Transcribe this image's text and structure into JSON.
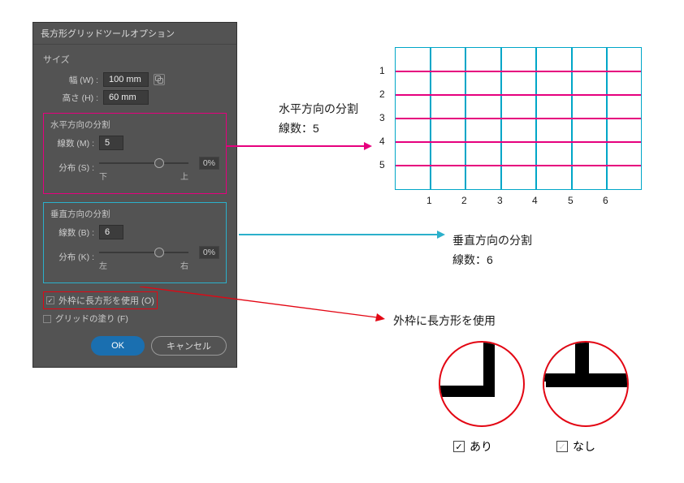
{
  "dialog": {
    "title": "長方形グリッドツールオプション",
    "section_size_label": "サイズ",
    "width_label": "幅 (W) :",
    "width_value": "100 mm",
    "height_label": "高さ (H) :",
    "height_value": "60 mm",
    "horiz_title": "水平方向の分割",
    "horiz_count_label": "線数 (M) :",
    "horiz_count_value": "5",
    "horiz_dist_label": "分布 (S) :",
    "horiz_dist_pct": "0%",
    "horiz_left": "下",
    "horiz_right": "上",
    "vert_title": "垂直方向の分割",
    "vert_count_label": "線数 (B) :",
    "vert_count_value": "6",
    "vert_dist_label": "分布 (K) :",
    "vert_dist_pct": "0%",
    "vert_left": "左",
    "vert_right": "右",
    "use_rect_label": "外枠に長方形を使用 (O)",
    "fill_grid_label": "グリッドの塗り (F)",
    "ok_label": "OK",
    "cancel_label": "キャンセル"
  },
  "annotations": {
    "horiz1": "水平方向の分割",
    "horiz2": "線数：5",
    "vert1": "垂直方向の分割",
    "vert2": "線数：6",
    "use_rect": "外枠に長方形を使用",
    "ari": "あり",
    "nashi": "なし"
  },
  "grid": {
    "row_labels": [
      "1",
      "2",
      "3",
      "4",
      "5"
    ],
    "col_labels": [
      "1",
      "2",
      "3",
      "4",
      "5",
      "6"
    ]
  }
}
